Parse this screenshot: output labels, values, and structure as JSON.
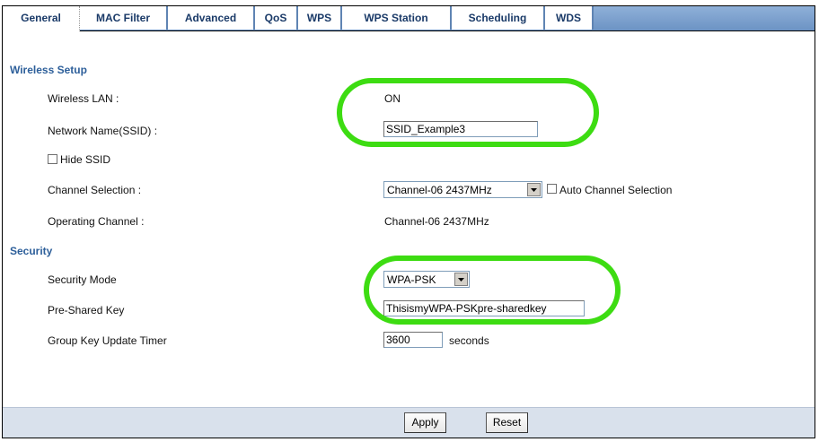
{
  "tabs": [
    {
      "label": "General",
      "active": true
    },
    {
      "label": "MAC Filter",
      "active": false
    },
    {
      "label": "Advanced",
      "active": false
    },
    {
      "label": "QoS",
      "active": false
    },
    {
      "label": "WPS",
      "active": false
    },
    {
      "label": "WPS Station",
      "active": false
    },
    {
      "label": "Scheduling",
      "active": false
    },
    {
      "label": "WDS",
      "active": false
    }
  ],
  "wireless_setup": {
    "heading": "Wireless Setup",
    "wireless_lan_label": "Wireless LAN :",
    "wireless_lan_value": "ON",
    "ssid_label": "Network Name(SSID) :",
    "ssid_value": "SSID_Example3",
    "hide_ssid_label": "Hide SSID",
    "channel_selection_label": "Channel Selection :",
    "channel_selection_value": "Channel-06 2437MHz",
    "auto_channel_label": "Auto Channel Selection",
    "operating_channel_label": "Operating Channel :",
    "operating_channel_value": "Channel-06 2437MHz"
  },
  "security": {
    "heading": "Security",
    "mode_label": "Security Mode",
    "mode_value": "WPA-PSK",
    "psk_label": "Pre-Shared Key",
    "psk_value": "ThisismyWPA-PSKpre-sharedkey",
    "timer_label": "Group Key Update Timer",
    "timer_value": "3600",
    "timer_unit": "seconds"
  },
  "footer": {
    "apply_label": "Apply",
    "reset_label": "Reset"
  },
  "colors": {
    "highlight": "#3ddc12",
    "section_heading": "#2d5f9a",
    "tab_text": "#1a3a68"
  }
}
